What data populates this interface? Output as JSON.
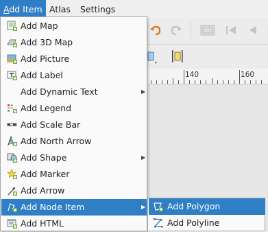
{
  "menubar": {
    "items": [
      {
        "label": "Add Item"
      },
      {
        "label": "Atlas"
      },
      {
        "label": "Settings"
      }
    ]
  },
  "menu": {
    "items": [
      {
        "label": "Add Map",
        "icon": "map-icon"
      },
      {
        "label": "Add 3D Map",
        "icon": "3d-map-icon"
      },
      {
        "label": "Add Picture",
        "icon": "picture-icon"
      },
      {
        "label": "Add Label",
        "icon": "label-icon"
      },
      {
        "label": "Add Dynamic Text",
        "icon": "none"
      },
      {
        "label": "Add Legend",
        "icon": "legend-icon"
      },
      {
        "label": "Add Scale Bar",
        "icon": "scale-bar-icon"
      },
      {
        "label": "Add North Arrow",
        "icon": "north-arrow-icon"
      },
      {
        "label": "Add Shape",
        "icon": "shape-icon"
      },
      {
        "label": "Add Marker",
        "icon": "marker-icon"
      },
      {
        "label": "Add Arrow",
        "icon": "arrow-icon"
      },
      {
        "label": "Add Node Item",
        "icon": "node-item-icon"
      },
      {
        "label": "Add HTML",
        "icon": "html-icon"
      }
    ]
  },
  "submenu": {
    "items": [
      {
        "label": "Add Polygon",
        "icon": "polygon-icon"
      },
      {
        "label": "Add Polyline",
        "icon": "polyline-icon"
      }
    ]
  },
  "ruler": {
    "labels": [
      "140",
      "160"
    ]
  },
  "colors": {
    "highlight": "#2f7fc7",
    "menu_bg": "#fafafa"
  }
}
